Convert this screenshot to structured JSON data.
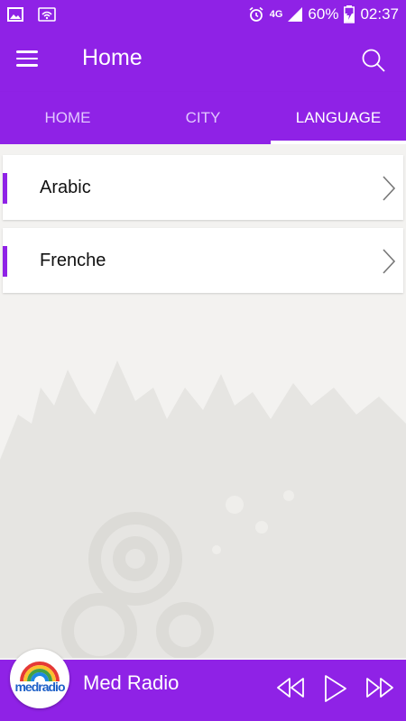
{
  "status_bar": {
    "battery": "60%",
    "time": "02:37",
    "network": "4G"
  },
  "app_bar": {
    "title": "Home"
  },
  "tabs": [
    {
      "label": "HOME",
      "active": false
    },
    {
      "label": "CITY",
      "active": false
    },
    {
      "label": "LANGUAGE",
      "active": true
    }
  ],
  "languages": [
    {
      "label": "Arabic"
    },
    {
      "label": "Frenche"
    }
  ],
  "player": {
    "logo_text": "medradio",
    "station": "Med Radio"
  },
  "colors": {
    "primary": "#8f22e6",
    "tab_inactive": "#e2c8ff",
    "background": "#f3f2f0"
  }
}
